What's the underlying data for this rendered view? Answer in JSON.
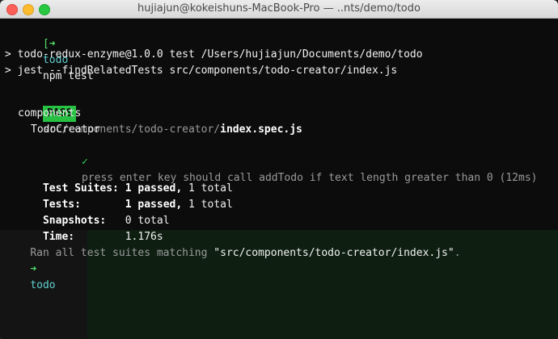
{
  "window": {
    "title": "hujiajun@kokeishuns-MacBook-Pro — ..nts/demo/todo"
  },
  "colors": {
    "background": "#0d0d0d",
    "text": "#f1f1f1",
    "prompt_green": "#4fe06a",
    "directory_cyan": "#5fd0d0",
    "pass_badge": "#27c043"
  },
  "terminal": {
    "line1": {
      "prompt_symbol": "[➜",
      "dir": "todo",
      "command": "npm test"
    },
    "line2": "> todo-redux-enzyme@1.0.0 test /Users/hujiajun/Documents/demo/todo",
    "line3": "> jest --findRelatedTests src/components/todo-creator/index.js",
    "pass_line": {
      "badge": "PASS",
      "path_dim": "src/components/todo-creator/",
      "file": "index.spec.js"
    },
    "suite1": "components",
    "suite2": "TodoCreator",
    "test_case": {
      "check": "✓",
      "text": "press enter key should call addTodo if text length greater than 0 (12ms)"
    },
    "summary": {
      "suites": {
        "label": "Test Suites:",
        "passed": "1 passed,",
        "total": "1 total"
      },
      "tests": {
        "label": "Tests:",
        "passed": "1 passed,",
        "total": "1 total"
      },
      "snapshots": {
        "label": "Snapshots:",
        "value": "0 total"
      },
      "time": {
        "label": "Time:",
        "value": "1.176s"
      }
    },
    "ran_line": {
      "prefix": "Ran all test suites matching ",
      "pattern": "\"src/components/todo-creator/index.js\"",
      "suffix": "."
    },
    "final_prompt": {
      "symbol": "➜",
      "dir": "todo"
    }
  }
}
